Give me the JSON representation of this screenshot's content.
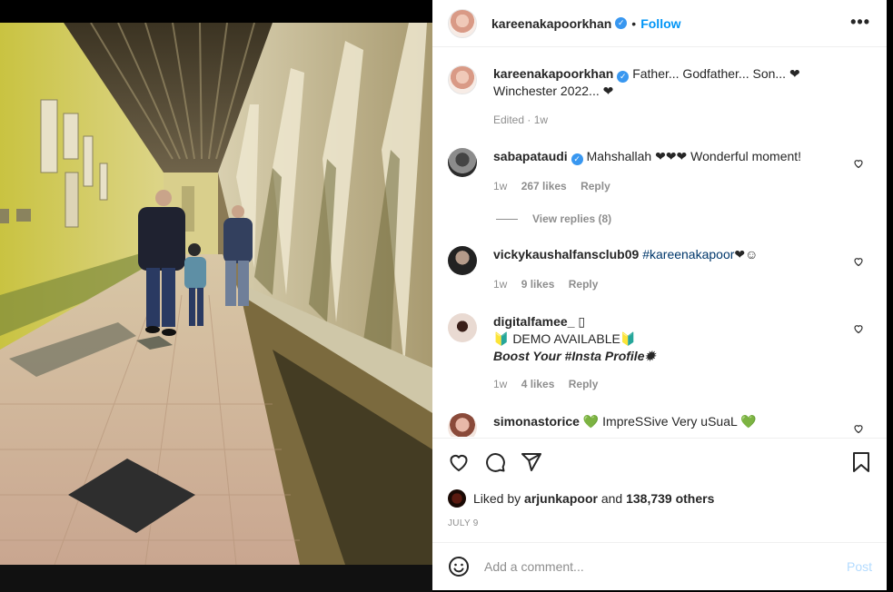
{
  "post": {
    "author": "kareenakapoorkhan",
    "separator": "•",
    "follow_label": "Follow",
    "more_label": "•••"
  },
  "caption": {
    "author": "kareenakapoorkhan",
    "text": "Father... Godfather... Son... ❤ Winchester 2022... ❤",
    "meta": "Edited · 1w"
  },
  "comments": [
    {
      "user": "sabapataudi",
      "verified": true,
      "text": "Mahshallah ❤❤❤ Wonderful moment!",
      "time": "1w",
      "likes": "267 likes",
      "reply": "Reply",
      "view_replies": "View replies (8)"
    },
    {
      "user": "vickykaushalfansclub09",
      "tag": "#kareenakapoor",
      "text_after": "❤☺",
      "time": "1w",
      "likes": "9 likes",
      "reply": "Reply"
    },
    {
      "user": "digitalfamee_",
      "suffix": "▯",
      "line2": "🔰 DEMO AVAILABLE🔰",
      "line3": "Boost Your #Insta Profile✹",
      "time": "1w",
      "likes": "4 likes",
      "reply": "Reply"
    },
    {
      "user": "simonastorice",
      "text": "💚 ImpreSSive Very uSuaL 💚"
    }
  ],
  "likes": {
    "prefix": "Liked by",
    "user": "arjunkapoor",
    "middle": "and",
    "others": "138,739 others"
  },
  "date": "JULY 9",
  "add_comment": {
    "placeholder": "Add a comment...",
    "post_label": "Post"
  },
  "colors": {
    "accent": "#0095f6",
    "verified": "#3897f0",
    "muted": "#8e8e8e",
    "post_disabled": "#b3dbff"
  },
  "icons": [
    "heart-icon",
    "comment-icon",
    "share-icon",
    "bookmark-icon",
    "emoji-icon",
    "more-icon",
    "verified-icon"
  ]
}
